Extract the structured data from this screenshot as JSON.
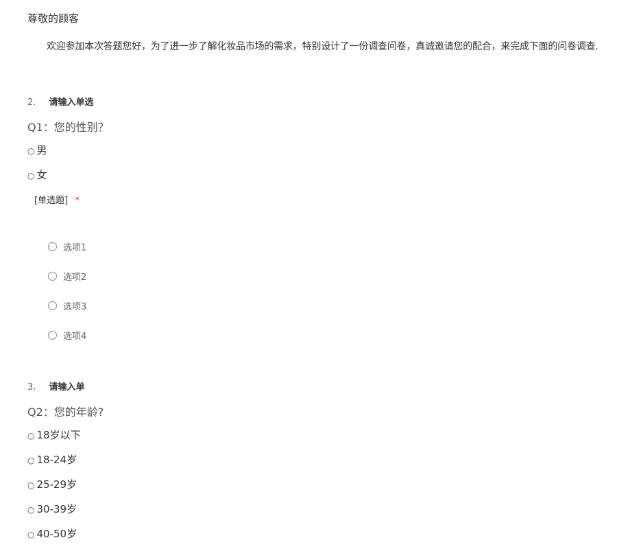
{
  "header": {
    "greeting": "尊敬的顾客",
    "intro": "欢迎参加本次答题您好，为了进一步了解化妆品市场的需求，特别设计了一份调查问卷，真诚邀请您的配合，来完成下面的问卷调查."
  },
  "question1": {
    "number": "2.",
    "title": "请输入单选",
    "text": "Q1：您的性别？",
    "static_options": [
      "男",
      "女"
    ],
    "type_tag": "[单选题]",
    "required_mark": "*",
    "radio_options": [
      "选项1",
      "选项2",
      "选项3",
      "选项4"
    ]
  },
  "question2": {
    "number": "3.",
    "title": "请输入单",
    "text": "Q2：您的年龄?",
    "static_options": [
      "18岁以下",
      "18-24岁",
      "25-29岁",
      "30-39岁",
      "40-50岁"
    ]
  },
  "icons": {
    "bullet": "circle-bullet-icon",
    "radio": "radio-button-icon"
  },
  "colors": {
    "required": "#e03a3a",
    "text": "#333333",
    "muted": "#666666"
  }
}
